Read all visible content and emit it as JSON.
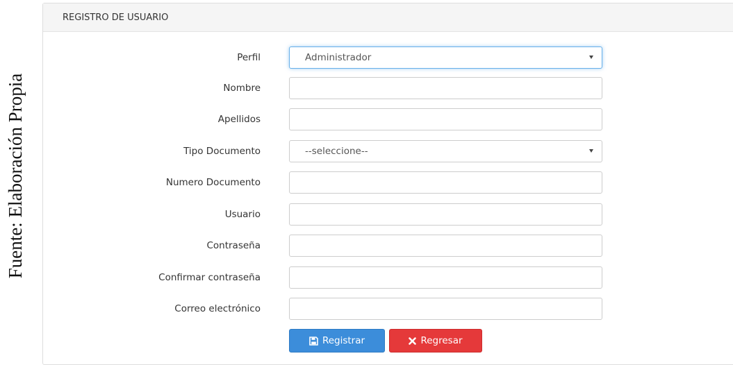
{
  "caption": "Fuente: Elaboración Propia",
  "panel": {
    "title": "REGISTRO DE USUARIO"
  },
  "form": {
    "perfil": {
      "label": "Perfil",
      "value": "Administrador"
    },
    "nombre": {
      "label": "Nombre",
      "value": ""
    },
    "apellidos": {
      "label": "Apellidos",
      "value": ""
    },
    "tipo_documento": {
      "label": "Tipo Documento",
      "value": "--seleccione--"
    },
    "numero_documento": {
      "label": "Numero Documento",
      "value": ""
    },
    "usuario": {
      "label": "Usuario",
      "value": ""
    },
    "contrasena": {
      "label": "Contraseña",
      "value": ""
    },
    "confirmar_contrasena": {
      "label": "Confirmar contraseña",
      "value": ""
    },
    "correo": {
      "label": "Correo electrónico",
      "value": ""
    }
  },
  "buttons": {
    "registrar": "Registrar",
    "regresar": "Regresar"
  },
  "colors": {
    "primary": "#3c8dda",
    "danger": "#e5393a",
    "focus": "#66afe9"
  },
  "icons": {
    "registrar": "floppy-disk-icon",
    "regresar": "close-icon"
  }
}
